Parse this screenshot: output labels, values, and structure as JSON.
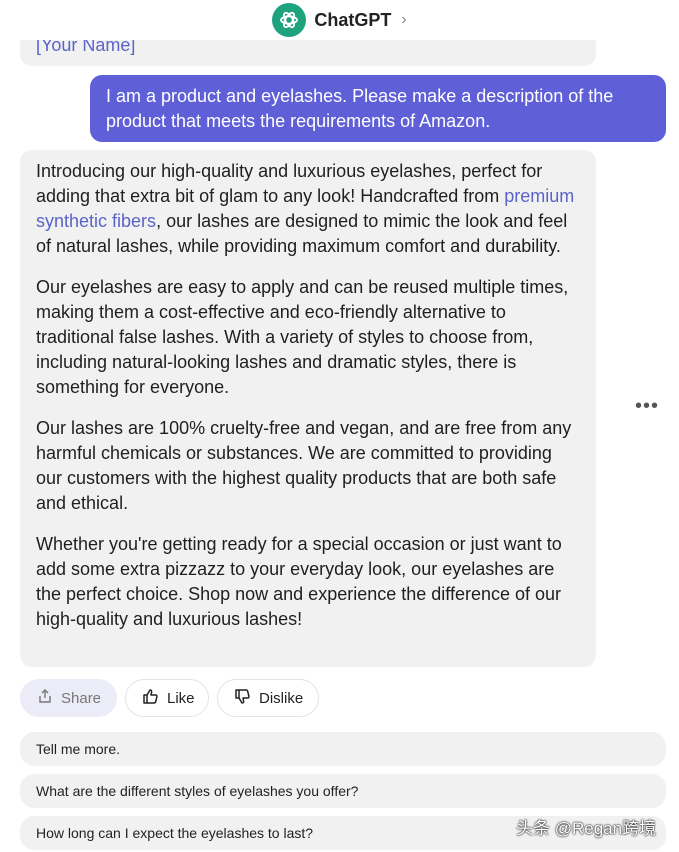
{
  "header": {
    "title": "ChatGPT",
    "chevron": "›",
    "logo_icon": "openai-logo-icon"
  },
  "previous_message": {
    "text": "[Your Name]"
  },
  "user_message": {
    "text": "I am a product and eyelashes. Please make a description of the product that meets the requirements of Amazon."
  },
  "assistant_message": {
    "p1_before": "Introducing our high-quality and luxurious eyelashes, perfect for adding that extra bit of glam to any look! Handcrafted from ",
    "p1_link": "premium synthetic fibers",
    "p1_after": ", our lashes are designed to mimic the look and feel of natural lashes, while providing maximum comfort and durability.",
    "p2": "Our eyelashes are easy to apply and can be reused multiple times, making them a cost-effective and eco-friendly alternative to traditional false lashes. With a variety of styles to choose from, including natural-looking lashes and dramatic styles, there is something for everyone.",
    "p3": "Our lashes are 100% cruelty-free and vegan, and are free from any harmful chemicals or substances. We are committed to providing our customers with the highest quality products that are both safe and ethical.",
    "p4": "Whether you're getting ready for a special occasion or just want to add some extra pizzazz to your everyday look, our eyelashes are the perfect choice. Shop now and experience the difference of our high-quality and luxurious lashes!"
  },
  "more_button": {
    "label": "•••"
  },
  "actions": {
    "share": "Share",
    "like": "Like",
    "dislike": "Dislike"
  },
  "suggestions": [
    "Tell me more.",
    "What are the different styles of eyelashes you offer?",
    "How long can I expect the eyelashes to last?"
  ],
  "watermark": {
    "text": "头条 @Regan跨境"
  },
  "colors": {
    "accent": "#5f5fd8",
    "bubble_bg": "#f1f1f2",
    "link": "#5a64c8",
    "logo_bg": "#1fa37f"
  }
}
